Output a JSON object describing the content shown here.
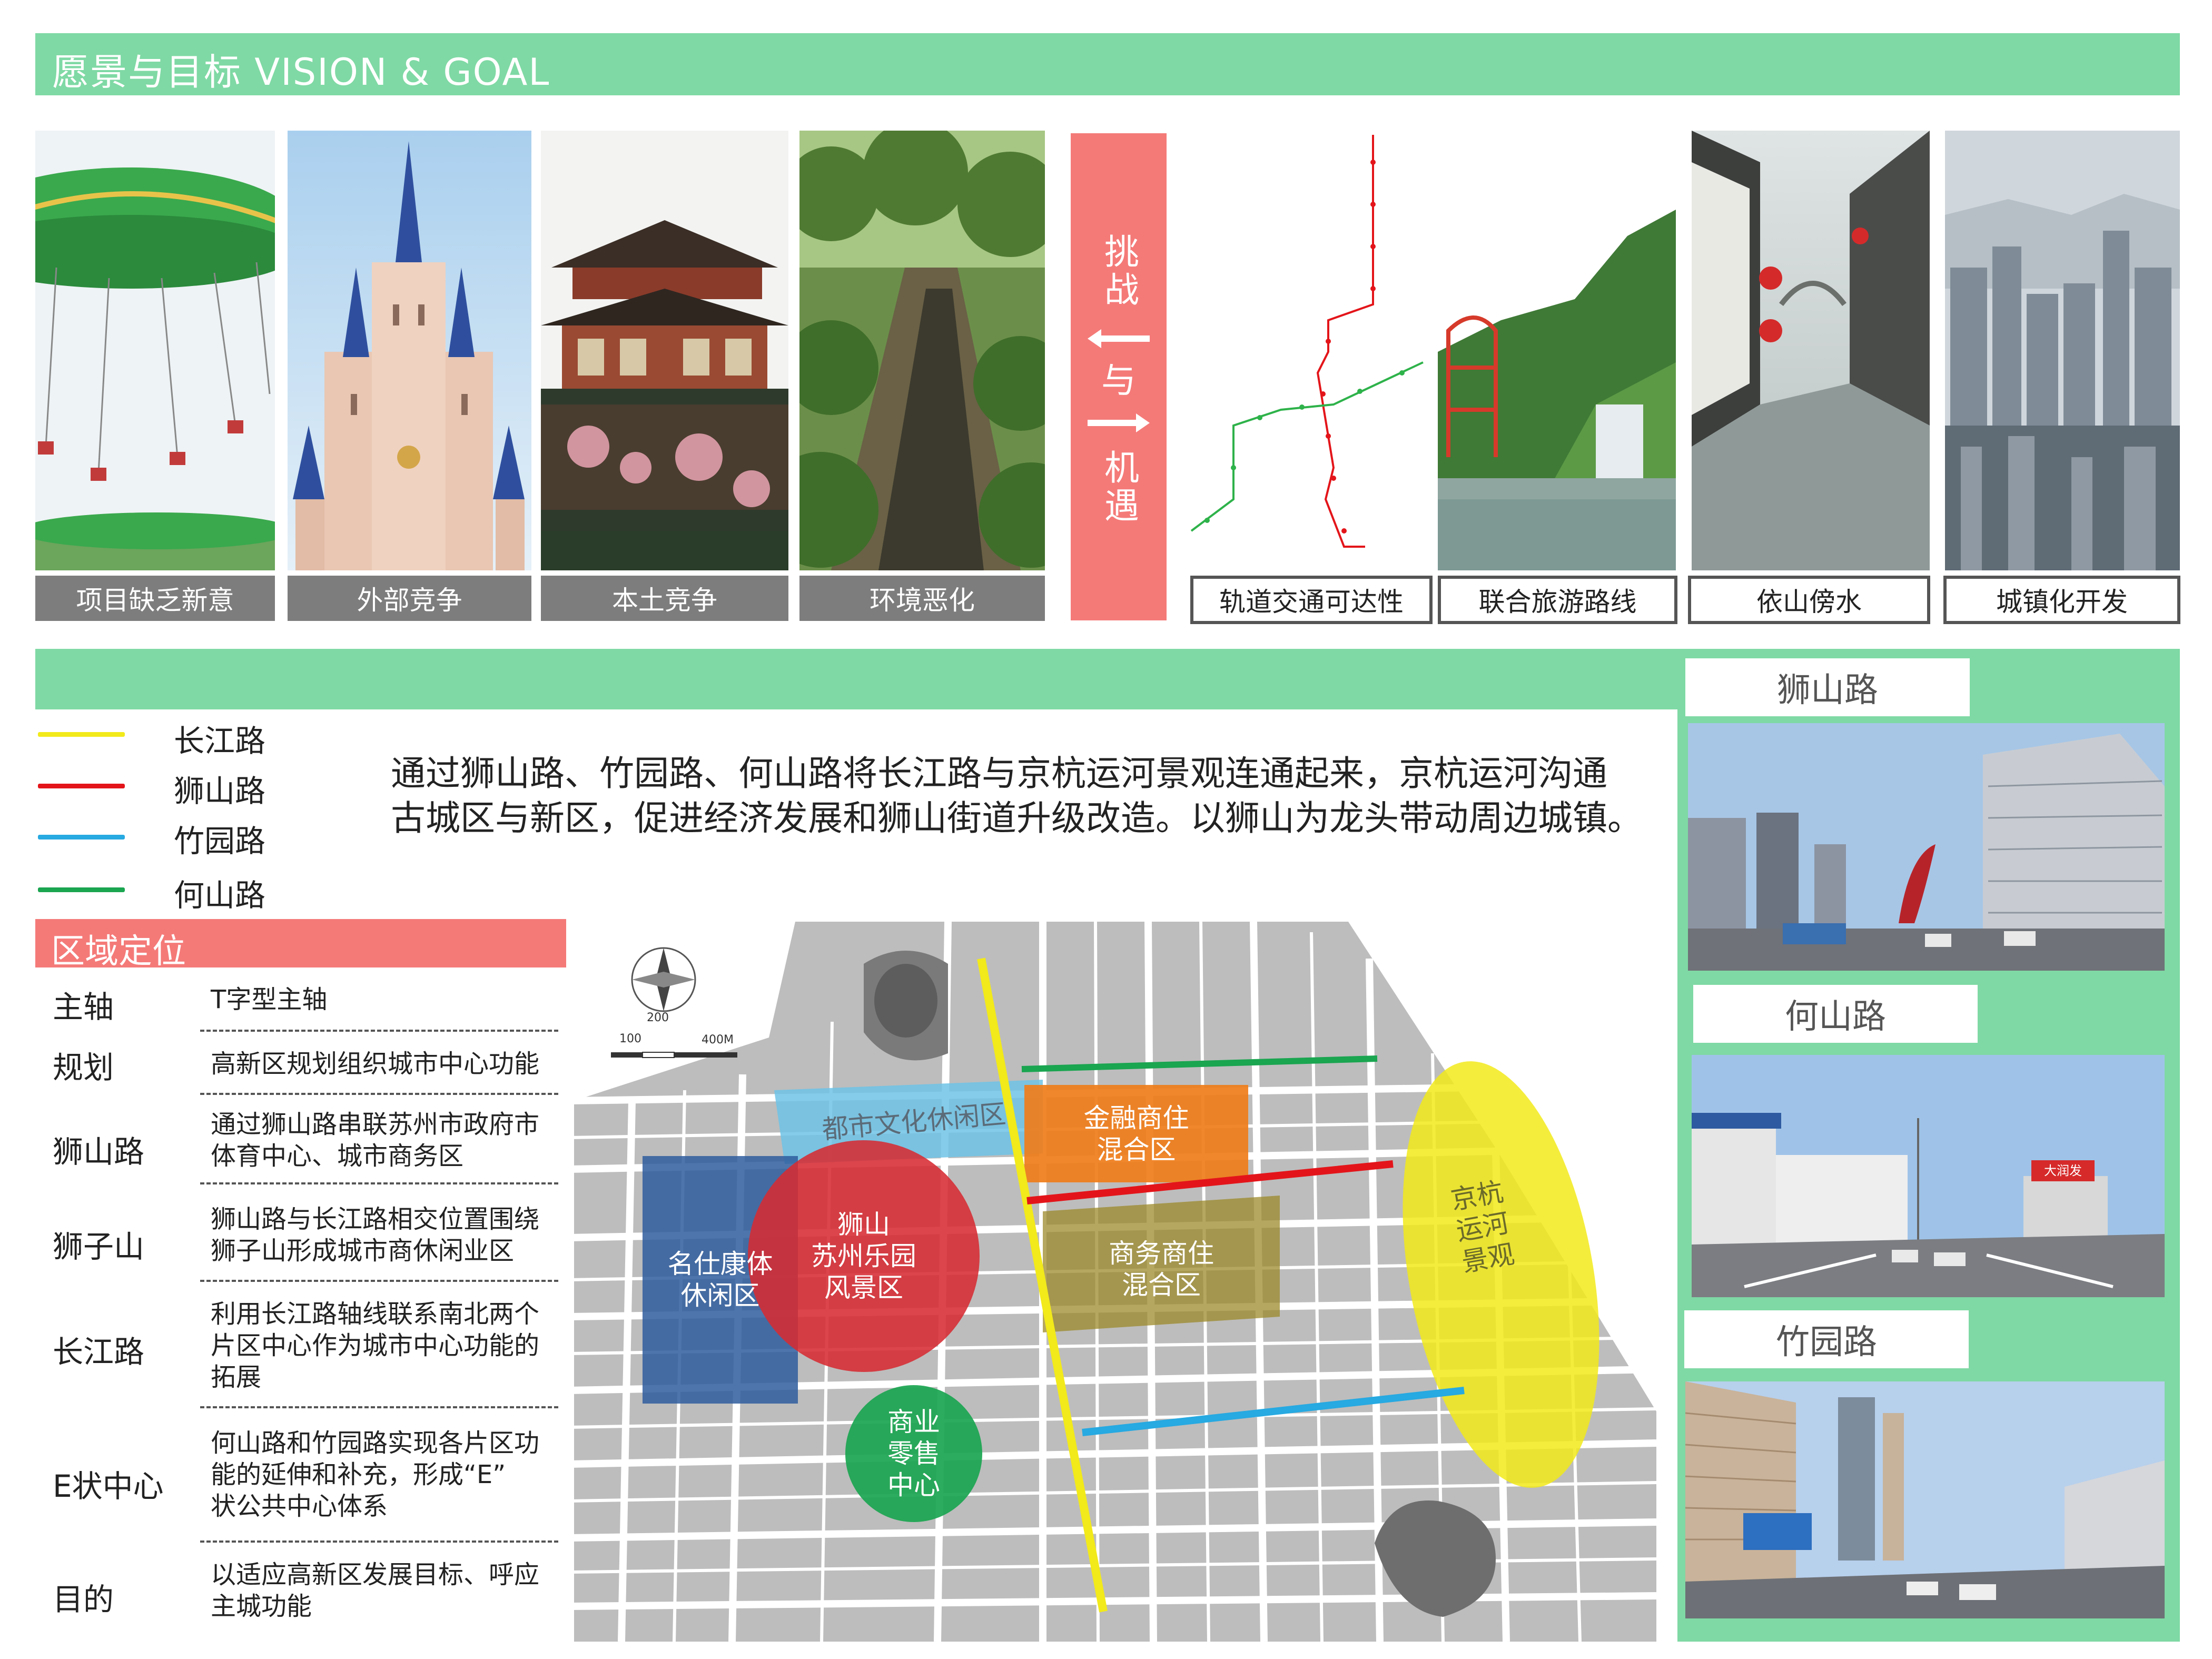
{
  "header": {
    "title": "愿景与目标 VISION & GOAL",
    "bar_color": "#7fd9a4"
  },
  "challenges": {
    "captions": [
      "项目缺乏新意",
      "外部竞争",
      "本土竞争",
      "环境恶化"
    ]
  },
  "center_banner": {
    "top": "挑战",
    "middle": "与",
    "bottom": "机遇",
    "color": "#f47a78"
  },
  "opportunities": {
    "captions": [
      "轨道交通可达性",
      "联合旅游路线",
      "依山傍水",
      "城镇化开发"
    ]
  },
  "legend": {
    "items": [
      {
        "label": "长江路",
        "color": "#f2ea1a"
      },
      {
        "label": "狮山路",
        "color": "#e3151a"
      },
      {
        "label": "竹园路",
        "color": "#27a9e1"
      },
      {
        "label": "何山路",
        "color": "#1aa550"
      }
    ]
  },
  "description": {
    "line1": "通过狮山路、竹园路、何山路将长江路与京杭运河景观连通起来，京杭运河沟通",
    "line2": "古城区与新区，促进经济发展和狮山街道升级改造。以狮山为龙头带动周边城镇。"
  },
  "positioning": {
    "title": "区域定位",
    "title_color": "#f47a78",
    "rows": [
      {
        "label": "主轴",
        "text": [
          "T字型主轴"
        ]
      },
      {
        "label": "规划",
        "text": [
          "高新区规划组织城市中心功能"
        ]
      },
      {
        "label": "狮山路",
        "text": [
          "通过狮山路串联苏州市政府市",
          "体育中心、城市商务区"
        ]
      },
      {
        "label": "狮子山",
        "text": [
          "狮山路与长江路相交位置围绕",
          "狮子山形成城市商休闲业区"
        ]
      },
      {
        "label": "长江路",
        "text": [
          "利用长江路轴线联系南北两个",
          "片区中心作为城市中心功能的",
          "拓展"
        ]
      },
      {
        "label": "E状中心",
        "text": [
          "何山路和竹园路实现各片区功",
          "能的延伸和补充，形成“E”",
          "状公共中心体系"
        ]
      },
      {
        "label": "目的",
        "text": [
          "以适应高新区发展目标、呼应",
          "主城功能"
        ]
      }
    ]
  },
  "map": {
    "scale_labels": [
      "100",
      "200",
      "400M"
    ],
    "zones": {
      "urban_leisure": "都市文化休闲区",
      "finance_mixed": [
        "金融商住",
        "混合区"
      ],
      "business_mixed": [
        "商务商住",
        "混合区"
      ],
      "mingshi": [
        "名仕康体",
        "休闲区"
      ],
      "shishan": [
        "狮山",
        "苏州乐园",
        "风景区"
      ],
      "retail": [
        "商业",
        "零售",
        "中心"
      ],
      "canal": [
        "京杭",
        "运河",
        "景观"
      ]
    }
  },
  "road_photos": {
    "labels": [
      "狮山路",
      "何山路",
      "竹园路"
    ],
    "sign_text": "大润发"
  }
}
